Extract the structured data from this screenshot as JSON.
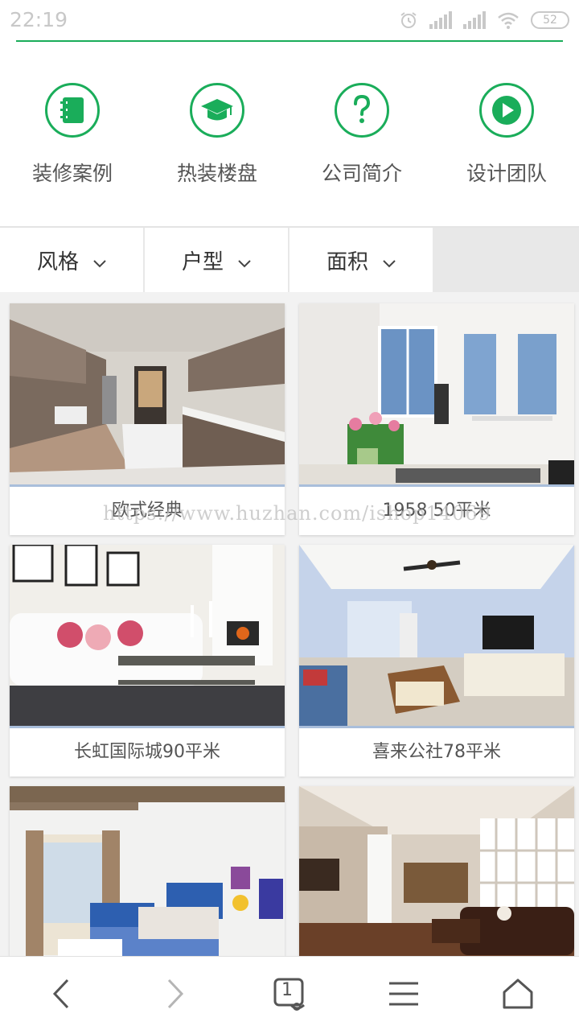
{
  "status_bar": {
    "time": "22:19",
    "battery": "52",
    "icons": [
      "alarm-icon",
      "signal-icon",
      "signal-icon",
      "wifi-icon",
      "battery-icon"
    ]
  },
  "quick_nav": [
    {
      "label": "装修案例",
      "icon": "notebook-icon"
    },
    {
      "label": "热装楼盘",
      "icon": "graduation-cap-icon"
    },
    {
      "label": "公司简介",
      "icon": "question-icon"
    },
    {
      "label": "设计团队",
      "icon": "play-icon"
    }
  ],
  "filters": [
    {
      "label": "风格",
      "icon": "chevron-down-icon"
    },
    {
      "label": "户型",
      "icon": "chevron-down-icon"
    },
    {
      "label": "面积",
      "icon": "chevron-down-icon"
    }
  ],
  "cases": [
    {
      "title": "欧式经典",
      "image": "kitchen-photo"
    },
    {
      "title": "1958 50平米",
      "image": "living-room-windows-photo"
    },
    {
      "title": "长虹国际城90平米",
      "image": "sofa-fireplace-photo"
    },
    {
      "title": "喜来公社78平米",
      "image": "blue-living-room-photo"
    },
    {
      "title": "",
      "image": "bedroom-photo"
    },
    {
      "title": "",
      "image": "loft-living-room-photo"
    }
  ],
  "watermark": "https://www.huzhan.com/ishop14069",
  "bottom_bar": {
    "tab_count": "1",
    "icons": [
      "back-icon",
      "forward-icon",
      "tabs-icon",
      "menu-icon",
      "home-icon"
    ]
  },
  "colors": {
    "accent": "#1aad5a",
    "card_accent": "#a9bedb"
  }
}
